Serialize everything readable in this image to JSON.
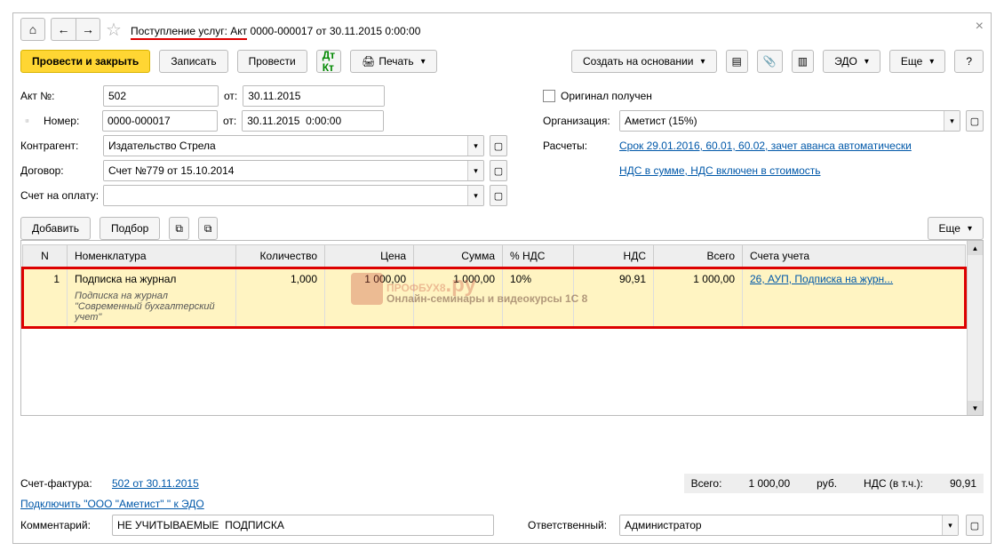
{
  "title_prefix": "Поступление услуг: Акт",
  "title_rest": " 0000-000017 от 30.11.2015 0:00:00",
  "toolbar": {
    "post_close": "Провести и закрыть",
    "save": "Записать",
    "post": "Провести",
    "print": "Печать",
    "create_based": "Создать на основании",
    "edo": "ЭДО",
    "more": "Еще",
    "help": "?"
  },
  "fields": {
    "akt_no_lbl": "Акт №:",
    "akt_no_val": "502",
    "date_lbl": "от:",
    "akt_date": "30.11.2015",
    "nomer_lbl": "Номер:",
    "nomer_val": "0000-000017",
    "nomer_date": "30.11.2015  0:00:00",
    "kontragent_lbl": "Контрагент:",
    "kontragent_val": "Издательство Стрела",
    "dogovor_lbl": "Договор:",
    "dogovor_val": "Счет №779 от 15.10.2014",
    "schet_lbl": "Счет на оплату:",
    "original_lbl": "Оригинал получен",
    "org_lbl": "Организация:",
    "org_val": "Аметист (15%)",
    "raschety_lbl": "Расчеты:",
    "raschety_link": "Срок 29.01.2016, 60.01, 60.02, зачет аванса автоматически",
    "nds_link": "НДС в сумме, НДС включен в стоимость"
  },
  "grid_toolbar": {
    "add": "Добавить",
    "select": "Подбор",
    "more": "Еще"
  },
  "columns": {
    "n": "N",
    "nomen": "Номенклатура",
    "qty": "Количество",
    "price": "Цена",
    "sum": "Сумма",
    "vat_pct": "% НДС",
    "vat": "НДС",
    "total": "Всего",
    "accounts": "Счета учета"
  },
  "rows": [
    {
      "n": "1",
      "nomen": "Подписка на журнал",
      "nomen_desc": "Подписка на журнал \"Современный бухгалтерский учет\"",
      "qty": "1,000",
      "price": "1 000,00",
      "sum": "1 000,00",
      "vat_pct": "10%",
      "vat": "90,91",
      "total": "1 000,00",
      "accounts": "26, АУП, Подписка на журн..."
    }
  ],
  "footer": {
    "sf_lbl": "Счет-фактура:",
    "sf_link": "502 от 30.11.2015",
    "edo_link": "Подключить \"ООО \"Аметист\" \" к ЭДО",
    "comment_lbl": "Комментарий:",
    "comment_val": "НЕ УЧИТЫВАЕМЫЕ  ПОДПИСКА",
    "resp_lbl": "Ответственный:",
    "resp_val": "Администратор",
    "total_lbl": "Всего:",
    "total_val": "1 000,00",
    "currency": "руб.",
    "vat_incl_lbl": "НДС (в т.ч.):",
    "vat_incl_val": "90,91"
  },
  "watermark": {
    "text": "ПРОФБУХ8",
    "domain": ".ру",
    "sub": "Онлайн-семинары и видеокурсы 1С 8"
  }
}
